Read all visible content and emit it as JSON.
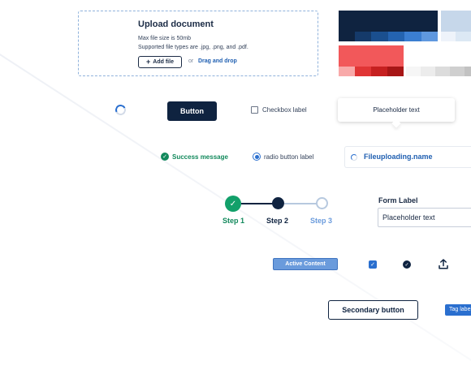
{
  "upload": {
    "title": "Upload document",
    "max_size": "Max file size is 50mb",
    "types": "Supported file types are .jpg, .png, and .pdf.",
    "add_file": "Add file",
    "or": "or",
    "drag_drop": "Drag and drop"
  },
  "palette": {
    "blues": [
      "#0f2340",
      "#153a6a",
      "#1a4f8f",
      "#2463b0",
      "#3b7ed1",
      "#5f98df"
    ],
    "light_blues": [
      "#c6d7ea",
      "#dce8f4",
      "#eef3fa"
    ],
    "reds": [
      "#f2585a",
      "#f8a9a9",
      "#e03535",
      "#c62020",
      "#a71616"
    ],
    "greys": [
      "#f6f6f6",
      "#ececec",
      "#dcdcdc",
      "#cfcfcf",
      "#c2c2c2"
    ]
  },
  "buttons": {
    "primary": "Button",
    "secondary": "Secondary button"
  },
  "checkbox": {
    "label": "Checkbox label",
    "checked": false
  },
  "tooltip": {
    "text": "Placeholder text"
  },
  "success": {
    "message": "Success message"
  },
  "radio": {
    "label": "radio button label",
    "selected": true
  },
  "file_uploading": {
    "name": "Fileuploading.name"
  },
  "stepper": {
    "steps": [
      {
        "label": "Step 1",
        "state": "completed"
      },
      {
        "label": "Step 2",
        "state": "current"
      },
      {
        "label": "Step 3",
        "state": "upcoming"
      }
    ]
  },
  "form": {
    "label": "Form Label",
    "placeholder": "Placeholder text"
  },
  "active_content": {
    "label": "Active Content"
  },
  "tag": {
    "label": "Tag label"
  },
  "icons": {
    "spinner": "loading-spinner-icon",
    "checkbox_checked": "checkbox-checked-icon",
    "check_circle": "check-circle-icon",
    "upload": "upload-icon",
    "plus": "plus-icon",
    "success": "success-check-icon"
  },
  "colors": {
    "navy": "#0f2340",
    "accent_blue": "#2a6fcf",
    "success_green": "#12895c",
    "step_green": "#12a06a"
  }
}
